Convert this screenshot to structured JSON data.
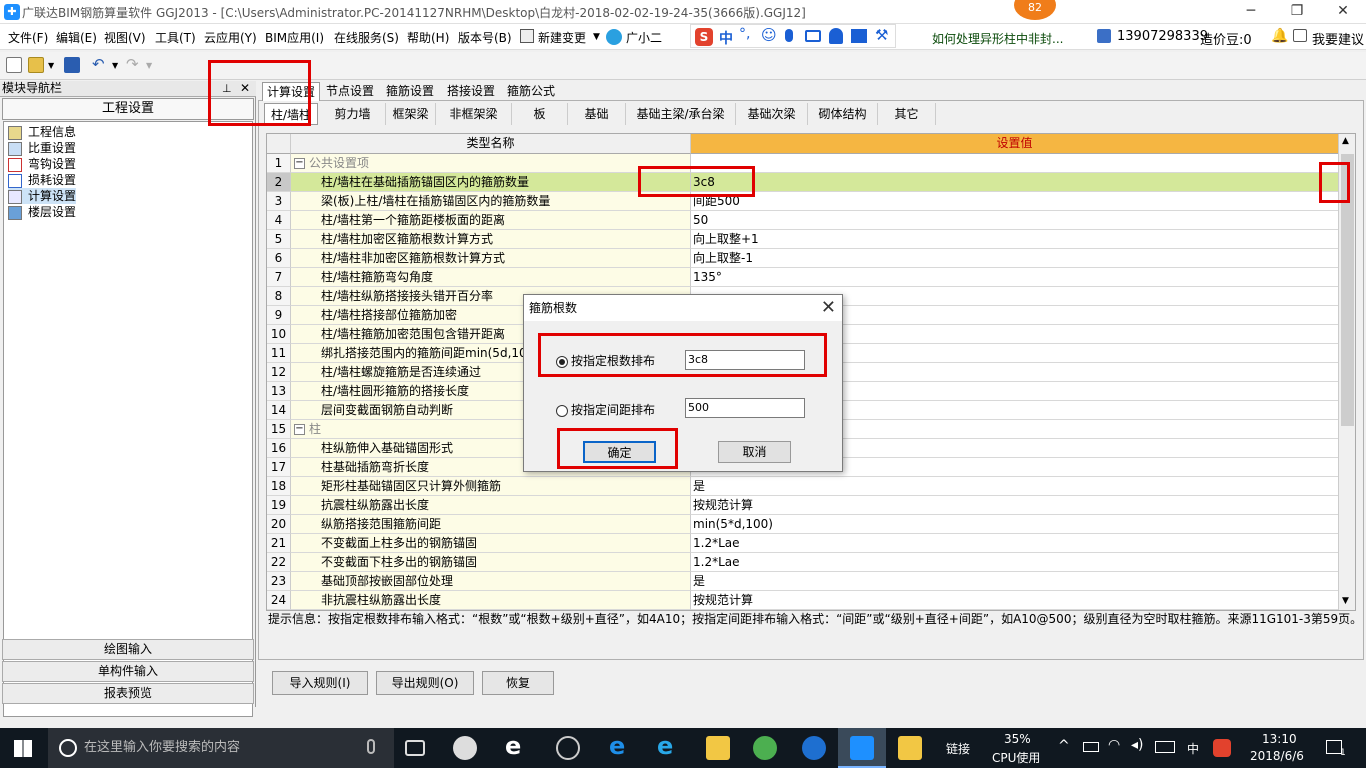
{
  "window": {
    "title": "广联达BIM钢筋算量软件 GGJ2013 - [C:\\Users\\Administrator.PC-20141127NRHM\\Desktop\\白龙村-2018-02-02-19-24-35(3666版).GGJ12]",
    "min": "─",
    "max": "❐",
    "close": "✕"
  },
  "badge": "82",
  "menubar": {
    "items": [
      "文件(F)",
      "编辑(E)",
      "视图(V)",
      "工具(T)",
      "云应用(Y)",
      "BIM应用(I)",
      "在线服务(S)",
      "帮助(H)",
      "版本号(B)"
    ],
    "new_change": "新建变更",
    "assistant": "广小二",
    "help_link": "如何处理异形柱中非封...",
    "phone": "13907298339",
    "cost_beans": "造价豆:0",
    "suggest": "我要建议",
    "ime_label": "中"
  },
  "leftnav": {
    "header": "模块导航栏",
    "pin": "ᴘ",
    "close": "✕",
    "section": "工程设置",
    "items": [
      "工程信息",
      "比重设置",
      "弯钩设置",
      "损耗设置",
      "计算设置",
      "楼层设置"
    ],
    "bottom": [
      "绘图输入",
      "单构件输入",
      "报表预览"
    ]
  },
  "tabs1": [
    "计算设置",
    "节点设置",
    "箍筋设置",
    "搭接设置",
    "箍筋公式"
  ],
  "tabs2": [
    "柱/墙柱",
    "剪力墙",
    "框架梁",
    "非框架梁",
    "板",
    "基础",
    "基础主梁/承台梁",
    "基础次梁",
    "砌体结构",
    "其它"
  ],
  "grid": {
    "col_name": "类型名称",
    "col_value": "设置值",
    "rows": [
      {
        "n": "1",
        "name": "公共设置项",
        "value": "",
        "group": true
      },
      {
        "n": "2",
        "name": "柱/墙柱在基础插筋锚固区内的箍筋数量",
        "value": "3c8",
        "selected": true
      },
      {
        "n": "3",
        "name": "梁(板)上柱/墙柱在插筋锚固区内的箍筋数量",
        "value": "间距500"
      },
      {
        "n": "4",
        "name": "柱/墙柱第一个箍筋距楼板面的距离",
        "value": "50"
      },
      {
        "n": "5",
        "name": "柱/墙柱加密区箍筋根数计算方式",
        "value": "向上取整+1"
      },
      {
        "n": "6",
        "name": "柱/墙柱非加密区箍筋根数计算方式",
        "value": "向上取整-1"
      },
      {
        "n": "7",
        "name": "柱/墙柱箍筋弯勾角度",
        "value": "135°"
      },
      {
        "n": "8",
        "name": "柱/墙柱纵筋搭接接头错开百分率",
        "value": ""
      },
      {
        "n": "9",
        "name": "柱/墙柱搭接部位箍筋加密",
        "value": ""
      },
      {
        "n": "10",
        "name": "柱/墙柱箍筋加密范围包含错开距离",
        "value": ""
      },
      {
        "n": "11",
        "name": "绑扎搭接范围内的箍筋间距min(5d,100",
        "value": ""
      },
      {
        "n": "12",
        "name": "柱/墙柱螺旋箍筋是否连续通过",
        "value": ""
      },
      {
        "n": "13",
        "name": "柱/墙柱圆形箍筋的搭接长度",
        "value": ""
      },
      {
        "n": "14",
        "name": "层间变截面钢筋自动判断",
        "value": ""
      },
      {
        "n": "15",
        "name": "柱",
        "value": "",
        "group": true
      },
      {
        "n": "16",
        "name": "柱纵筋伸入基础锚固形式",
        "value": ""
      },
      {
        "n": "17",
        "name": "柱基础插筋弯折长度",
        "value": ""
      },
      {
        "n": "18",
        "name": "矩形柱基础锚固区只计算外侧箍筋",
        "value": "是"
      },
      {
        "n": "19",
        "name": "抗震柱纵筋露出长度",
        "value": "按规范计算"
      },
      {
        "n": "20",
        "name": "纵筋搭接范围箍筋间距",
        "value": "min(5*d,100)"
      },
      {
        "n": "21",
        "name": "不变截面上柱多出的钢筋锚固",
        "value": "1.2*Lae"
      },
      {
        "n": "22",
        "name": "不变截面下柱多出的钢筋锚固",
        "value": "1.2*Lae"
      },
      {
        "n": "23",
        "name": "基础顶部按嵌固部位处理",
        "value": "是"
      },
      {
        "n": "24",
        "name": "非抗震柱纵筋露出长度",
        "value": "按规范计算"
      }
    ]
  },
  "hint": "提示信息：按指定根数排布输入格式：“根数”或“根数+级别+直径”，如4A10；按指定间距排布输入格式：“间距”或“级别+直径+间距”，如A10@500；级别直径为空时取柱箍筋。来源11G101-3第59页。",
  "bottom_buttons": [
    "导入规则(I)",
    "导出规则(O)",
    "恢复"
  ],
  "dialog": {
    "title": "箍筋根数",
    "close": "✕",
    "opt1_label": "按指定根数排布",
    "opt1_value": "3c8",
    "opt2_label": "按指定间距排布",
    "opt2_value": "500",
    "ok": "确定",
    "cancel": "取消"
  },
  "taskbar": {
    "search_placeholder": "在这里输入你要搜索的内容",
    "link": "链接",
    "cpu_pct": "35%",
    "cpu_label": "CPU使用",
    "ime": "中",
    "time": "13:10",
    "date": "2018/6/6",
    "notif": "1"
  },
  "colors": {
    "selected_row": "#d4e89a",
    "value_header": "#f5b642",
    "name_col": "#fdfce6",
    "highlight": "#e00000"
  }
}
